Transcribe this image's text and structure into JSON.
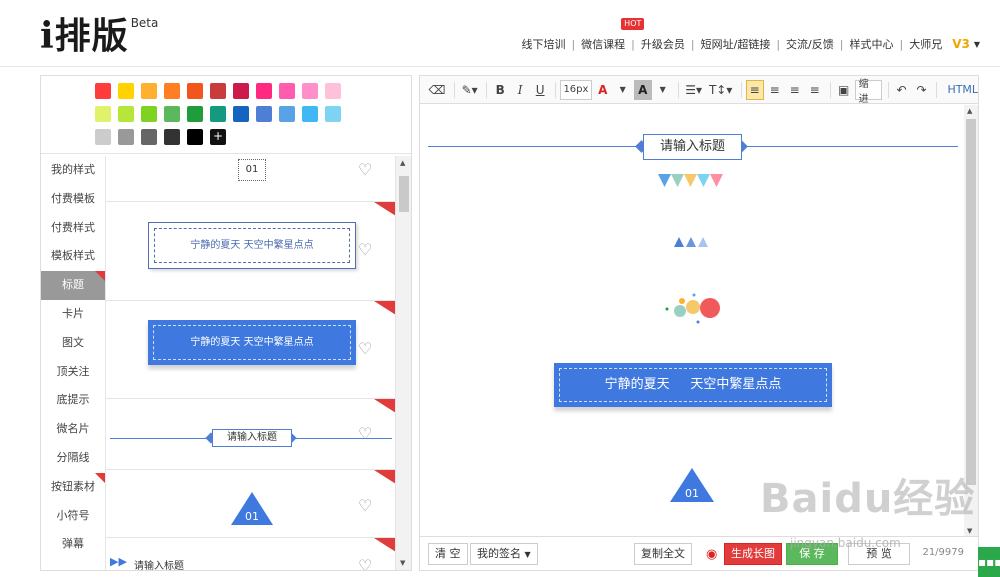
{
  "logo": {
    "main": "i排版",
    "beta": "Beta"
  },
  "topnav": {
    "items": [
      "线下培训",
      "微信课程",
      "升级会员",
      "短网址/超链接",
      "交流/反馈",
      "样式中心",
      "大师兄"
    ],
    "hot_badge": "HOT",
    "vip": "V3"
  },
  "palette": {
    "rows": [
      [
        "#ff3b3b",
        "#ffd200",
        "#ffb02e",
        "#ff7e24",
        "#f2551d",
        "#c93c3c",
        "#cc1a4d",
        "#ff2a7f",
        "#ff5cae",
        "#ff8fcb",
        "#ffc1d9"
      ],
      [
        "#dff26a",
        "#b6e63a",
        "#7ed321",
        "#5cb85c",
        "#1f9d3a",
        "#159a7f",
        "#1565c0",
        "#4f7fd4",
        "#5aa2e6",
        "#3fb8f5",
        "#7fd3f2"
      ],
      [
        "#cccccc",
        "#999999",
        "#666666",
        "#333333",
        "#000000"
      ]
    ],
    "plus_label": "+"
  },
  "categories": [
    "我的样式",
    "付费模板",
    "付费样式",
    "模板样式",
    "标题",
    "卡片",
    "图文",
    "顶关注",
    "底提示",
    "微名片",
    "分隔线",
    "按钮素材",
    "小符号",
    "弹幕"
  ],
  "active_category": "标题",
  "templates": {
    "t1_number": "01",
    "t2_text": "宁静的夏天 天空中繁星点点",
    "t3_text": "宁静的夏天 天空中繁星点点",
    "t4_text": "请输入标题",
    "t5_number": "01",
    "t6_text": "请输入标题"
  },
  "toolbar": {
    "font_size": "16px",
    "bold": "B",
    "italic": "I",
    "underline": "U",
    "font_color": "A",
    "bg_color": "A",
    "line_height": "T",
    "indent": "缩进",
    "html": "HTML"
  },
  "editor": {
    "title_placeholder": "请输入标题",
    "banner_text": "宁静的夏天     天空中繁星点点",
    "triangle_number": "01"
  },
  "bottombar": {
    "clear": "清 空",
    "signature": "我的签名",
    "copy_all": "复制全文",
    "gen_image": "生成长图",
    "save": "保 存",
    "preview": "预 览",
    "counter": "21/9979"
  },
  "watermark": {
    "main": "Baidu经验",
    "sub": "jingyan.baidu.com"
  }
}
